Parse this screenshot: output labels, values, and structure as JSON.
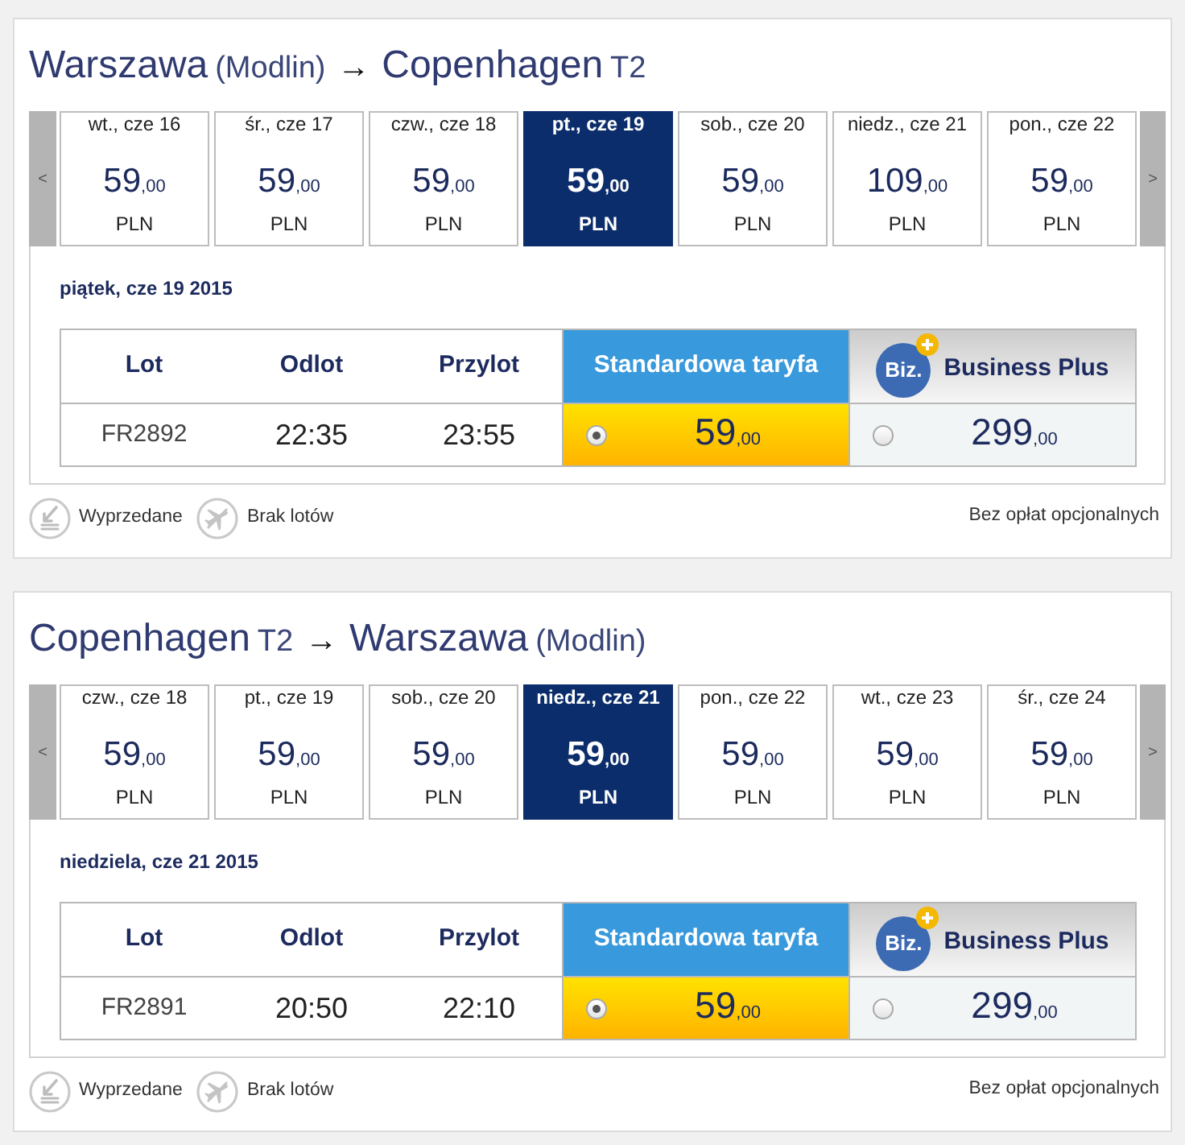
{
  "flights": [
    {
      "route": [
        {
          "kind": "city",
          "text": "Warszawa"
        },
        {
          "kind": "note",
          "text": "(Modlin)"
        },
        {
          "kind": "arrow",
          "text": "→"
        },
        {
          "kind": "city",
          "text": "Copenhagen"
        },
        {
          "kind": "note",
          "text": "T2"
        }
      ],
      "prev_button": "<",
      "next_button": ">",
      "dates": [
        {
          "label": "wt., cze 16",
          "amount": "59",
          "decimals": ",00",
          "currency": "PLN",
          "selected": false
        },
        {
          "label": "śr., cze 17",
          "amount": "59",
          "decimals": ",00",
          "currency": "PLN",
          "selected": false
        },
        {
          "label": "czw., cze 18",
          "amount": "59",
          "decimals": ",00",
          "currency": "PLN",
          "selected": false
        },
        {
          "label": "pt., cze 19",
          "amount": "59",
          "decimals": ",00",
          "currency": "PLN",
          "selected": true
        },
        {
          "label": "sob., cze 20",
          "amount": "59",
          "decimals": ",00",
          "currency": "PLN",
          "selected": false
        },
        {
          "label": "niedz., cze 21",
          "amount": "109",
          "decimals": ",00",
          "currency": "PLN",
          "selected": false
        },
        {
          "label": "pon., cze 22",
          "amount": "59",
          "decimals": ",00",
          "currency": "PLN",
          "selected": false
        }
      ],
      "selected_day": "piątek, cze 19 2015",
      "table": {
        "columns": [
          "Lot",
          "Odlot",
          "Przylot"
        ],
        "fares": [
          {
            "kind": "standard",
            "label": "Standardowa taryfa"
          },
          {
            "kind": "business",
            "logo": "Biz.",
            "label": "Business Plus"
          }
        ],
        "rows": [
          {
            "flight": "FR2892",
            "departure": "22:35",
            "arrival": "23:55",
            "fares": [
              {
                "amount": "59",
                "decimals": ",00",
                "selected": true
              },
              {
                "amount": "299",
                "decimals": ",00",
                "selected": false
              }
            ]
          }
        ]
      },
      "legend": [
        {
          "kind": "sold-out",
          "label": "Wyprzedane"
        },
        {
          "kind": "no-flights",
          "label": "Brak lotów"
        }
      ],
      "note": "Bez opłat opcjonalnych"
    },
    {
      "route": [
        {
          "kind": "city",
          "text": "Copenhagen"
        },
        {
          "kind": "note",
          "text": "T2"
        },
        {
          "kind": "arrow",
          "text": "→"
        },
        {
          "kind": "city",
          "text": "Warszawa"
        },
        {
          "kind": "note",
          "text": "(Modlin)"
        }
      ],
      "prev_button": "<",
      "next_button": ">",
      "dates": [
        {
          "label": "czw., cze 18",
          "amount": "59",
          "decimals": ",00",
          "currency": "PLN",
          "selected": false
        },
        {
          "label": "pt., cze 19",
          "amount": "59",
          "decimals": ",00",
          "currency": "PLN",
          "selected": false
        },
        {
          "label": "sob., cze 20",
          "amount": "59",
          "decimals": ",00",
          "currency": "PLN",
          "selected": false
        },
        {
          "label": "niedz., cze 21",
          "amount": "59",
          "decimals": ",00",
          "currency": "PLN",
          "selected": true
        },
        {
          "label": "pon., cze 22",
          "amount": "59",
          "decimals": ",00",
          "currency": "PLN",
          "selected": false
        },
        {
          "label": "wt., cze 23",
          "amount": "59",
          "decimals": ",00",
          "currency": "PLN",
          "selected": false
        },
        {
          "label": "śr., cze 24",
          "amount": "59",
          "decimals": ",00",
          "currency": "PLN",
          "selected": false
        }
      ],
      "selected_day": "niedziela, cze 21 2015",
      "table": {
        "columns": [
          "Lot",
          "Odlot",
          "Przylot"
        ],
        "fares": [
          {
            "kind": "standard",
            "label": "Standardowa taryfa"
          },
          {
            "kind": "business",
            "logo": "Biz.",
            "label": "Business Plus"
          }
        ],
        "rows": [
          {
            "flight": "FR2891",
            "departure": "20:50",
            "arrival": "22:10",
            "fares": [
              {
                "amount": "59",
                "decimals": ",00",
                "selected": true
              },
              {
                "amount": "299",
                "decimals": ",00",
                "selected": false
              }
            ]
          }
        ]
      },
      "legend": [
        {
          "kind": "sold-out",
          "label": "Wyprzedane"
        },
        {
          "kind": "no-flights",
          "label": "Brak lotów"
        }
      ],
      "note": "Bez opłat opcjonalnych"
    }
  ]
}
